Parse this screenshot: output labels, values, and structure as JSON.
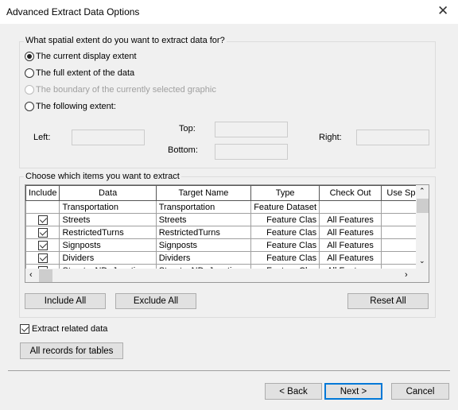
{
  "window": {
    "title": "Advanced Extract Data Options",
    "close_icon": "close-icon"
  },
  "extent": {
    "label": "What spatial extent do you want to extract data for?",
    "options": [
      {
        "label": "The current display extent",
        "selected": true,
        "enabled": true
      },
      {
        "label": "The full extent of the data",
        "selected": false,
        "enabled": true
      },
      {
        "label": "The boundary of the currently selected graphic",
        "selected": false,
        "enabled": false
      },
      {
        "label": "The following extent:",
        "selected": false,
        "enabled": true
      }
    ],
    "left_label": "Left:",
    "top_label": "Top:",
    "bottom_label": "Bottom:",
    "right_label": "Right:",
    "left": "",
    "top": "",
    "bottom": "",
    "right": ""
  },
  "items": {
    "label": "Choose which items you want to extract",
    "columns": [
      "Include",
      "Data",
      "Target Name",
      "Type",
      "Check Out",
      "Use Spat"
    ],
    "rows": [
      {
        "include": null,
        "data": "Transportation",
        "target": "Transportation",
        "type": "Feature Dataset",
        "checkout": "",
        "spatial": null
      },
      {
        "include": true,
        "data": "Streets",
        "target": "Streets",
        "type": "Feature Clas",
        "checkout": "All Features",
        "spatial": true
      },
      {
        "include": true,
        "data": "RestrictedTurns",
        "target": "RestrictedTurns",
        "type": "Feature Clas",
        "checkout": "All Features",
        "spatial": true
      },
      {
        "include": true,
        "data": "Signposts",
        "target": "Signposts",
        "type": "Feature Clas",
        "checkout": "All Features",
        "spatial": true
      },
      {
        "include": true,
        "data": "Dividers",
        "target": "Dividers",
        "type": "Feature Clas",
        "checkout": "All Features",
        "spatial": true
      },
      {
        "include": true,
        "data": "Streets_ND_Junctions",
        "target": "Streets_ND_Junctions",
        "type": "Feature Clas",
        "checkout": "All Features",
        "spatial": true
      }
    ],
    "include_all": "Include All",
    "exclude_all": "Exclude All",
    "reset_all": "Reset All"
  },
  "extract_related": {
    "label": "Extract related data",
    "checked": true
  },
  "all_records": "All records for tables",
  "footer": {
    "back": "< Back",
    "next": "Next >",
    "cancel": "Cancel"
  }
}
